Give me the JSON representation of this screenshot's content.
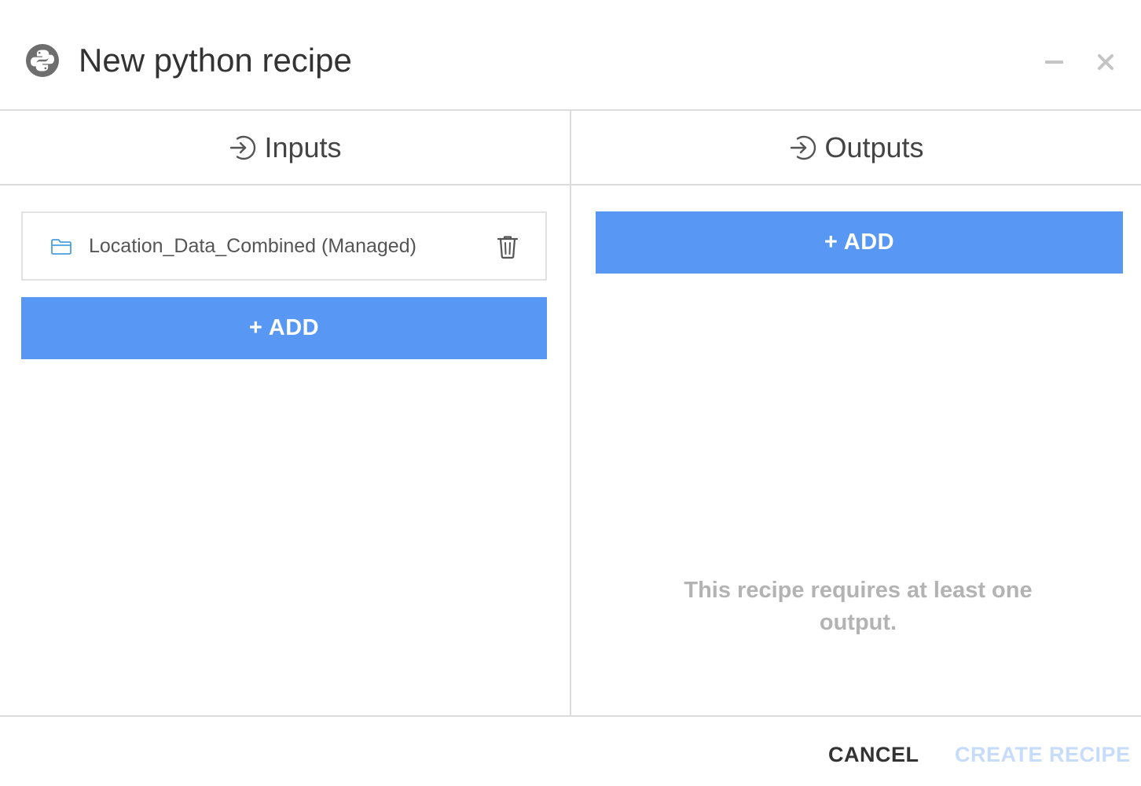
{
  "dialog": {
    "title": "New python recipe",
    "app_icon": "python-icon",
    "minimize_icon": "minimize-icon",
    "close_icon": "close-icon"
  },
  "inputs": {
    "header": "Inputs",
    "header_icon": "sign-in-arrow-icon",
    "items": [
      {
        "label": "Location_Data_Combined (Managed)",
        "icon": "folder-icon",
        "delete_icon": "trash-icon"
      }
    ],
    "add_label": "+ ADD"
  },
  "outputs": {
    "header": "Outputs",
    "header_icon": "sign-in-arrow-icon",
    "add_label": "+ ADD",
    "empty_message": "This recipe requires at least one output."
  },
  "footer": {
    "cancel_label": "CANCEL",
    "create_label": "CREATE RECIPE",
    "create_disabled": true
  },
  "colors": {
    "accent": "#5898f4",
    "disabled_text": "#c6dcfa",
    "muted_text": "#b3b3b3",
    "border": "#dcdcdc",
    "folder_icon": "#4a9fe0"
  }
}
